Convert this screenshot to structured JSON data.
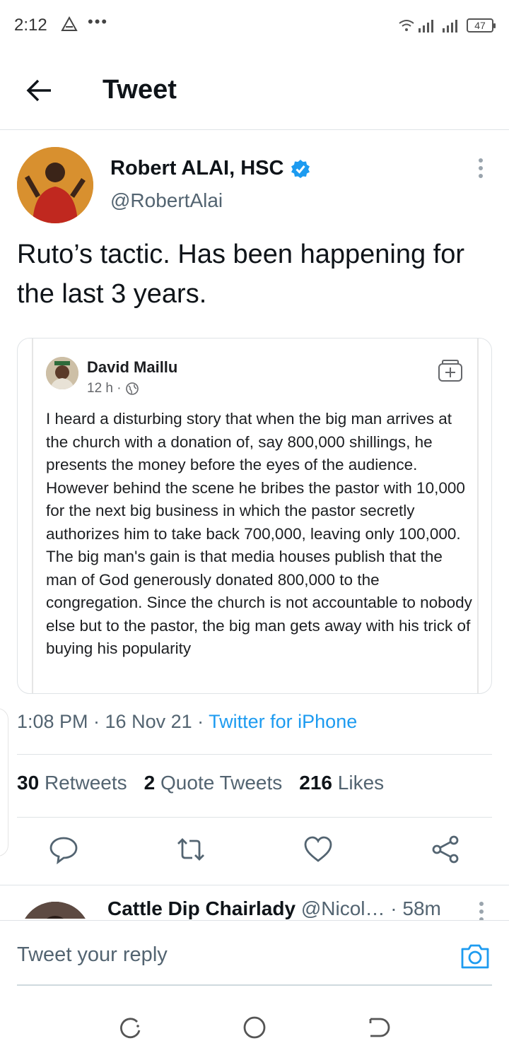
{
  "status_bar": {
    "time": "2:12",
    "battery": "47"
  },
  "header": {
    "title": "Tweet"
  },
  "tweet": {
    "author_name": "Robert ALAI, HSC",
    "author_handle": "@RobertAlai",
    "text": "Ruto’s tactic. Has been happening for the last 3 years.",
    "timestamp": "1:08 PM · 16 Nov 21 · ",
    "source": "Twitter for iPhone"
  },
  "embedded_post": {
    "author": "David Maillu",
    "age": "12 h ·",
    "body": "I heard a disturbing story that when the big man arrives at the church with a donation of, say 800,000 shillings, he presents the money before the eyes of the audience. However behind the scene he bribes the pastor with 10,000 for the next big business in which the pastor secretly authorizes him to take back 700,000, leaving only 100,000. The big man's gain is that media houses publish that the man of God generously donated 800,000 to the congregation. Since the church is not accountable to nobody else but to the pastor, the big man gets away with his trick of buying his popularity"
  },
  "stats": {
    "retweets_count": "30",
    "retweets_label": "Retweets",
    "quotes_count": "2",
    "quotes_label": "Quote Tweets",
    "likes_count": "216",
    "likes_label": "Likes"
  },
  "actions": [
    "reply-icon",
    "retweet-icon",
    "like-icon",
    "share-icon"
  ],
  "reply_preview": {
    "name": "Cattle Dip Chairlady",
    "handle": " @Nicol…",
    "time": " · 58m"
  },
  "composer": {
    "placeholder": "Tweet your reply"
  },
  "colors": {
    "accent": "#1d9bf0",
    "text": "#0f1419",
    "muted": "#536471",
    "verified": "#1d9bf0"
  }
}
